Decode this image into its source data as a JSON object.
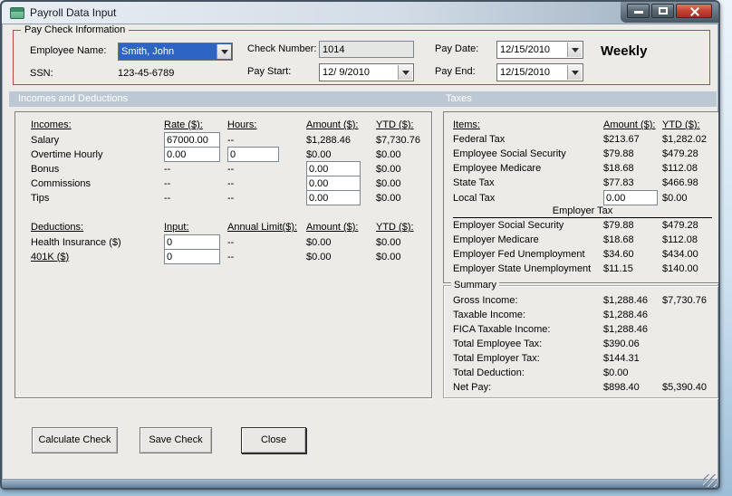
{
  "window": {
    "title": "Payroll Data Input"
  },
  "paycheck": {
    "group_label": "Pay Check Information",
    "employee_name_label": "Employee Name:",
    "employee_name_value": "Smith, John",
    "ssn_label": "SSN:",
    "ssn_value": "123-45-6789",
    "check_number_label": "Check Number:",
    "check_number_value": "1014",
    "pay_start_label": "Pay Start:",
    "pay_start_value": "12/ 9/2010",
    "pay_date_label": "Pay Date:",
    "pay_date_value": "12/15/2010",
    "pay_end_label": "Pay End:",
    "pay_end_value": "12/15/2010",
    "frequency": "Weekly"
  },
  "section_headers": {
    "left": "Incomes and Deductions",
    "right": "Taxes"
  },
  "incomes": {
    "headers": {
      "name": "Incomes:",
      "rate": "Rate ($):",
      "hours": "Hours:",
      "amount": "Amount ($):",
      "ytd": "YTD ($):"
    },
    "rows": [
      {
        "label": "Salary",
        "rate_input": "67000.00",
        "hours": "--",
        "amount": "$1,288.46",
        "ytd": "$7,730.76"
      },
      {
        "label": "Overtime Hourly",
        "rate_input": "0.00",
        "hours_input": "0",
        "amount": "$0.00",
        "ytd": "$0.00"
      },
      {
        "label": "Bonus",
        "rate": "--",
        "hours": "--",
        "amount_input": "0.00",
        "ytd": "$0.00"
      },
      {
        "label": "Commissions",
        "rate": "--",
        "hours": "--",
        "amount_input": "0.00",
        "ytd": "$0.00"
      },
      {
        "label": "Tips",
        "rate": "--",
        "hours": "--",
        "amount_input": "0.00",
        "ytd": "$0.00"
      }
    ]
  },
  "deductions": {
    "headers": {
      "name": "Deductions:",
      "input": "Input:",
      "annual_limit": "Annual Limit($):",
      "amount": "Amount ($):",
      "ytd": "YTD ($):"
    },
    "rows": [
      {
        "label": "Health Insurance  ($)",
        "input": "0",
        "annual_limit": "--",
        "amount": "$0.00",
        "ytd": "$0.00"
      },
      {
        "label": "401K  ($)",
        "input": "0",
        "annual_limit": "--",
        "amount": "$0.00",
        "ytd": "$0.00"
      }
    ]
  },
  "taxes": {
    "headers": {
      "items": "Items:",
      "amount": "Amount ($):",
      "ytd": "YTD ($):"
    },
    "employee_rows": [
      {
        "label": "Federal Tax",
        "amount": "$213.67",
        "ytd": "$1,282.02"
      },
      {
        "label": "Employee Social Security",
        "amount": "$79.88",
        "ytd": "$479.28"
      },
      {
        "label": "Employee Medicare",
        "amount": "$18.68",
        "ytd": "$112.08"
      },
      {
        "label": "State Tax",
        "amount": "$77.83",
        "ytd": "$466.98"
      },
      {
        "label": "Local Tax",
        "amount_input": "0.00",
        "ytd": "$0.00"
      }
    ],
    "employer_header": "Employer Tax",
    "employer_rows": [
      {
        "label": "Employer Social Security",
        "amount": "$79.88",
        "ytd": "$479.28"
      },
      {
        "label": "Employer Medicare",
        "amount": "$18.68",
        "ytd": "$112.08"
      },
      {
        "label": "Employer Fed Unemployment",
        "amount": "$34.60",
        "ytd": "$434.00"
      },
      {
        "label": "Employer State Unemployment",
        "amount": "$11.15",
        "ytd": "$140.00"
      }
    ]
  },
  "summary": {
    "group_label": "Summary",
    "rows": [
      {
        "label": "Gross Income:",
        "amount": "$1,288.46",
        "ytd": "$7,730.76"
      },
      {
        "label": "Taxable Income:",
        "amount": "$1,288.46",
        "ytd": ""
      },
      {
        "label": "FICA Taxable Income:",
        "amount": "$1,288.46",
        "ytd": ""
      },
      {
        "label": "Total Employee Tax:",
        "amount": "$390.06",
        "ytd": ""
      },
      {
        "label": "Total Employer Tax:",
        "amount": "$144.31",
        "ytd": ""
      },
      {
        "label": "Total Deduction:",
        "amount": "$0.00",
        "ytd": ""
      },
      {
        "label": "Net Pay:",
        "amount": "$898.40",
        "ytd": "$5,390.40"
      }
    ]
  },
  "buttons": {
    "calculate": "Calculate Check",
    "save": "Save Check",
    "close": "Close"
  },
  "colors": {
    "group_border": "#B5473E",
    "section_bar": "#BCC9D4",
    "selection_blue": "#2E65C4",
    "close_button_red": "#C74534"
  }
}
